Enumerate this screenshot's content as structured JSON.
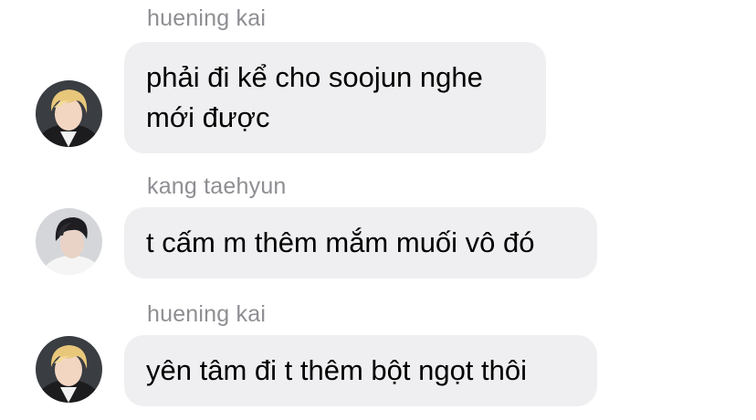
{
  "messages": [
    {
      "sender": "huening kai",
      "avatar_icon": "blonde-person-avatar-icon",
      "lines": [
        "phải đi kể cho soojun nghe",
        "mới được"
      ]
    },
    {
      "sender": "kang taehyun",
      "avatar_icon": "dark-haired-person-avatar-icon",
      "lines": [
        "t cấm m thêm mắm muối vô đó"
      ]
    },
    {
      "sender": "huening kai",
      "avatar_icon": "blonde-person-avatar-icon",
      "lines": [
        "yên tâm đi t thêm bột ngọt thôi"
      ]
    }
  ],
  "colors": {
    "bubble_bg": "#efeff1",
    "sender_text": "#8e8e93",
    "message_text": "#000000"
  }
}
